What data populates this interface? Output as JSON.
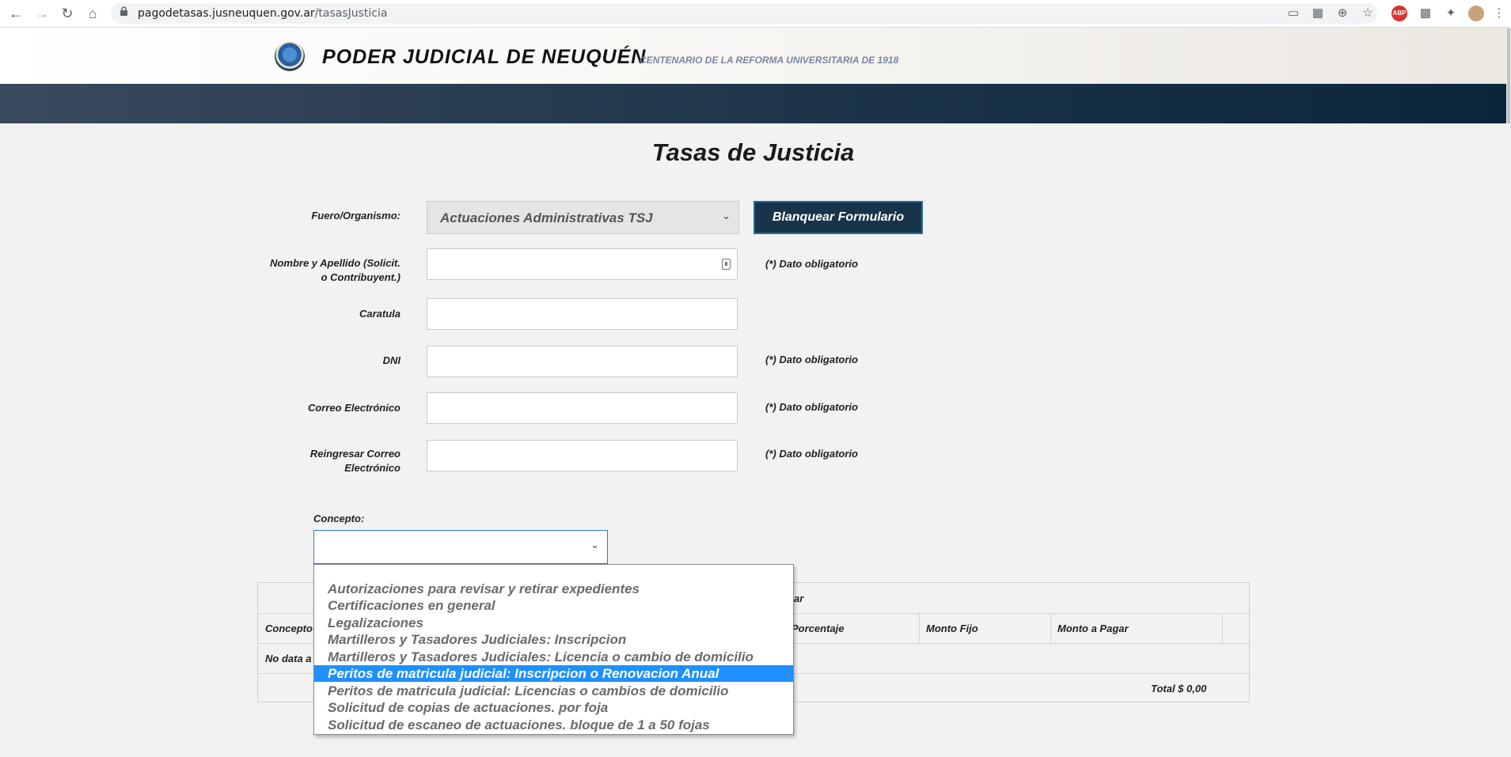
{
  "browser": {
    "url_host": "pagodetasas.jusneuquen.gov.ar",
    "url_path": "/tasasJusticia",
    "abp_label": "ABP"
  },
  "header": {
    "title": "PODER JUDICIAL DE NEUQUÉN",
    "subtitle": "CENTENARIO DE LA REFORMA UNIVERSITARIA DE 1918"
  },
  "page": {
    "title": "Tasas de Justicia"
  },
  "form": {
    "fuero_label": "Fuero/Organismo:",
    "fuero_value": "Actuaciones Administrativas TSJ",
    "clear_button": "Blanquear Formulario",
    "nombre_label_1": "Nombre y Apellido (Solicit.",
    "nombre_label_2": "o Contribuyent.)",
    "caratula_label": "Caratula",
    "dni_label": "DNI",
    "correo_label": "Correo Electrónico",
    "reingresar_label_1": "Reingresar Correo",
    "reingresar_label_2": "Electrónico",
    "required_note": "(*) Dato obligatorio",
    "concepto_label": "Concepto:"
  },
  "table": {
    "header_partial": "ar",
    "col_concepto": "Concepto",
    "col_porcentaje": "Porcentaje",
    "col_monto_fijo": "Monto Fijo",
    "col_monto_pagar": "Monto a Pagar",
    "no_data": "No data a",
    "total": "Total $ 0,00"
  },
  "dropdown": {
    "options": [
      "Autorizaciones para revisar y retirar expedientes",
      "Certificaciones en general",
      "Legalizaciones",
      "Martilleros y Tasadores Judiciales: Inscripcion",
      "Martilleros y Tasadores Judiciales: Licencia o cambio de domicilio",
      "Peritos de matricula judicial: Inscripcion o Renovacion Anual",
      "Peritos de matricula judicial: Licencias o cambios de domicilio",
      "Solicitud de copias de actuaciones. por foja",
      "Solicitud de escaneo de actuaciones. bloque de 1 a 50 fojas"
    ],
    "selected_index": 5
  }
}
